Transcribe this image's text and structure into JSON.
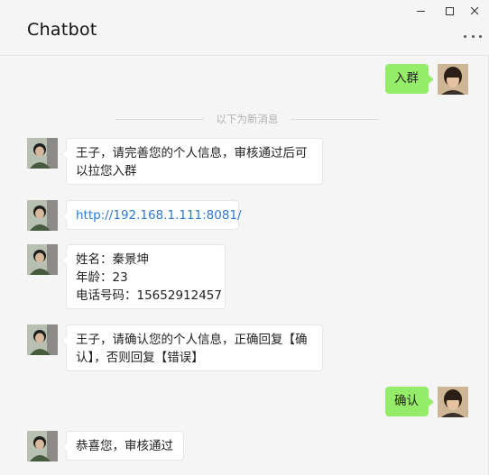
{
  "window": {
    "title": "Chatbot"
  },
  "divider_text": "以下为新消息",
  "messages": [
    {
      "side": "right",
      "text": "入群"
    },
    {
      "side": "left",
      "lines": [
        "王子，请完善您的个人信息，审核通过后可",
        "以拉您入群"
      ]
    },
    {
      "side": "left",
      "text": "http://192.168.1.111:8081/"
    },
    {
      "side": "left",
      "lines": [
        "姓名：秦景坤",
        "年龄：23",
        "电话号码：15652912457"
      ]
    },
    {
      "side": "left",
      "lines": [
        "王子，请确认您的个人信息，正确回复【确",
        "认】，否则回复【错误】"
      ]
    },
    {
      "side": "right",
      "text": "确认"
    },
    {
      "side": "left",
      "text": "恭喜您，审核通过"
    }
  ],
  "colors": {
    "background": "#f5f5f5",
    "self_bubble": "#95ec69",
    "bot_bubble": "#ffffff",
    "link": "#2b7bd6"
  },
  "icons": {
    "minimize": "minimize-icon",
    "maximize": "maximize-icon",
    "close": "close-icon",
    "more": "more-icon"
  }
}
